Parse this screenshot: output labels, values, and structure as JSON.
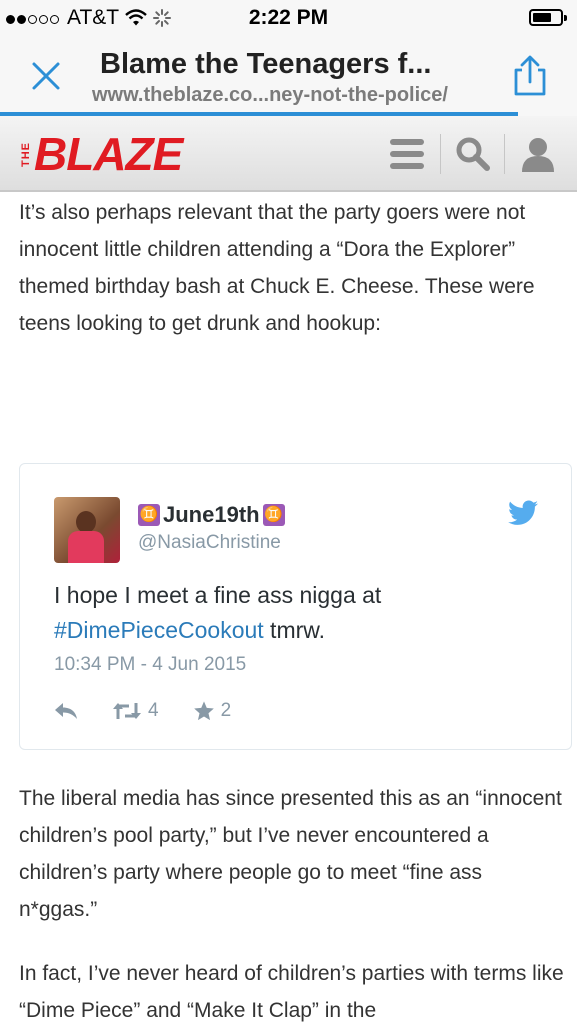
{
  "status_bar": {
    "carrier": "AT&T",
    "time": "2:22 PM"
  },
  "browser": {
    "page_title": "Blame the Teenagers f...",
    "url": "www.theblaze.co...ney-not-the-police/",
    "accent_color": "#2c8fd6"
  },
  "site": {
    "logo_small": "THE",
    "logo_word": "BLAZE",
    "brand_color": "#e01b22",
    "icons": [
      "menu-icon",
      "search-icon",
      "user-icon"
    ]
  },
  "article": {
    "paragraph_1": "It’s also perhaps relevant that the party goers were not innocent little children attending a “Dora the Explorer” themed birthday bash at Chuck E. Cheese. These were teens looking to get drunk and hookup:",
    "paragraph_2": "The liberal media has since presented this as an “innocent children’s pool party,” but I’ve never encountered a children’s party where people go to meet “fine ass n*ggas.”",
    "paragraph_3": "In fact, I’ve never heard of children’s parties with terms like “Dime Piece” and “Make It Clap” in the"
  },
  "tweet": {
    "display_name": "June19th",
    "name_emoji": "♊",
    "handle": "@NasiaChristine",
    "text_before": "I hope I meet a fine ass nigga at ",
    "hashtag": "#DimePieceCookout",
    "text_after": " tmrw.",
    "timestamp": "10:34 PM - 4 Jun 2015",
    "retweets": "4",
    "favorites": "2",
    "link_color": "#2b7bb9"
  }
}
